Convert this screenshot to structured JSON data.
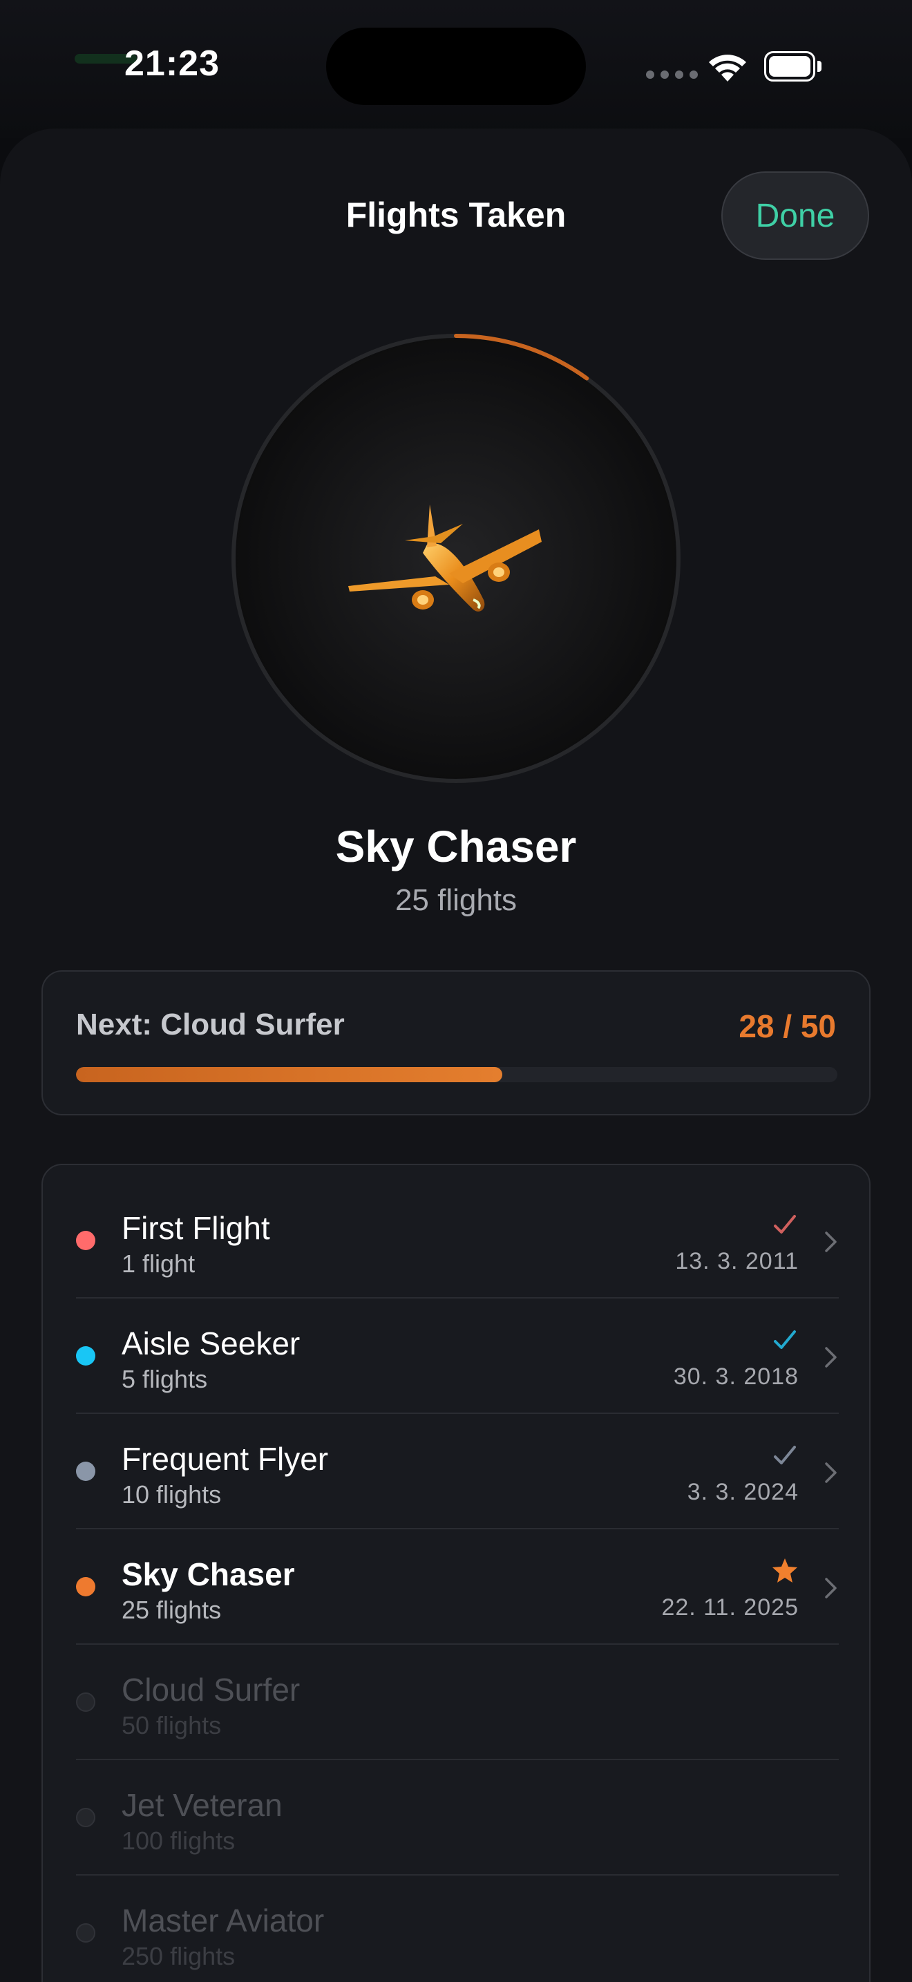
{
  "status_bar": {
    "time": "21:23"
  },
  "sheet": {
    "title": "Flights Taken",
    "done_label": "Done"
  },
  "badge": {
    "name": "Sky Chaser",
    "count_label": "25 flights",
    "ring_progress": 0.1,
    "ring_color": "#c8641f"
  },
  "next": {
    "label": "Next: Cloud Surfer",
    "progress_text": "28 / 50",
    "progress_fraction": 0.56
  },
  "milestones": [
    {
      "title": "First Flight",
      "subtitle": "1 flight",
      "date": "13. 3. 2011",
      "dot_color": "#ff6b6b",
      "mark": "check",
      "mark_color": "#d0605e",
      "state": "earned"
    },
    {
      "title": "Aisle Seeker",
      "subtitle": "5 flights",
      "date": "30. 3. 2018",
      "dot_color": "#19c6f5",
      "mark": "check",
      "mark_color": "#23a9cf",
      "state": "earned"
    },
    {
      "title": "Frequent Flyer",
      "subtitle": "10 flights",
      "date": "3. 3. 2024",
      "dot_color": "#8a96a8",
      "mark": "check",
      "mark_color": "#7d8797",
      "state": "earned"
    },
    {
      "title": "Sky Chaser",
      "subtitle": "25 flights",
      "date": "22. 11. 2025",
      "dot_color": "#ee7a2f",
      "mark": "star",
      "mark_color": "#f0802e",
      "state": "current"
    },
    {
      "title": "Cloud Surfer",
      "subtitle": "50 flights",
      "date": "",
      "dot_color": "#24262b",
      "mark": "",
      "mark_color": "",
      "state": "locked"
    },
    {
      "title": "Jet Veteran",
      "subtitle": "100 flights",
      "date": "",
      "dot_color": "#24262b",
      "mark": "",
      "mark_color": "",
      "state": "locked"
    },
    {
      "title": "Master Aviator",
      "subtitle": "250 flights",
      "date": "",
      "dot_color": "#24262b",
      "mark": "",
      "mark_color": "",
      "state": "locked"
    }
  ]
}
